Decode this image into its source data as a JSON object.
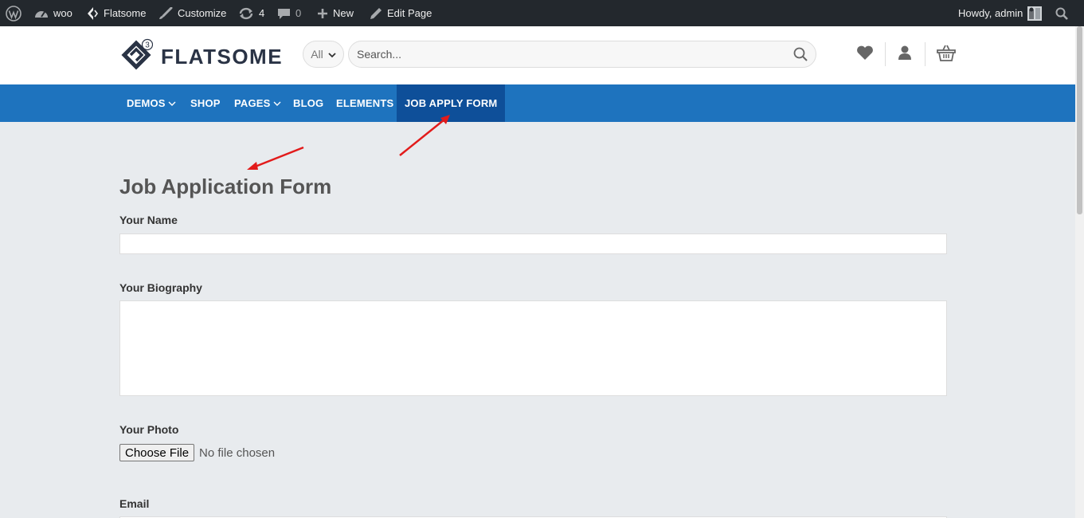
{
  "adminbar": {
    "wp_logo_icon": "wordpress-icon",
    "site_name": "woo",
    "theme": "Flatsome",
    "customize": "Customize",
    "updates_count": "4",
    "comments_count": "0",
    "new": "New",
    "edit_page": "Edit Page",
    "howdy": "Howdy, admin"
  },
  "header": {
    "logo_text": "FLATSOME",
    "logo_badge": "3",
    "category_select": "All",
    "search_placeholder": "Search..."
  },
  "nav": {
    "items": [
      {
        "label": "DEMOS",
        "has_dropdown": true
      },
      {
        "label": "SHOP",
        "has_dropdown": false
      },
      {
        "label": "PAGES",
        "has_dropdown": true
      },
      {
        "label": "BLOG",
        "has_dropdown": false
      },
      {
        "label": "ELEMENTS",
        "has_dropdown": false
      },
      {
        "label": "JOB APPLY FORM",
        "has_dropdown": false,
        "active": true
      }
    ]
  },
  "form": {
    "title": "Job Application Form",
    "name_label": "Your Name",
    "name_value": "",
    "bio_label": "Your Biography",
    "photo_label": "Your Photo",
    "choose_file": "Choose File",
    "no_file": "No file chosen",
    "email_label": "Email"
  },
  "colors": {
    "adminbar_bg": "#23282d",
    "nav_bg": "#1e73be",
    "nav_active_bg": "#0e4f99",
    "page_bg": "#e8ebee",
    "annotation_arrow": "#e21b1b"
  }
}
